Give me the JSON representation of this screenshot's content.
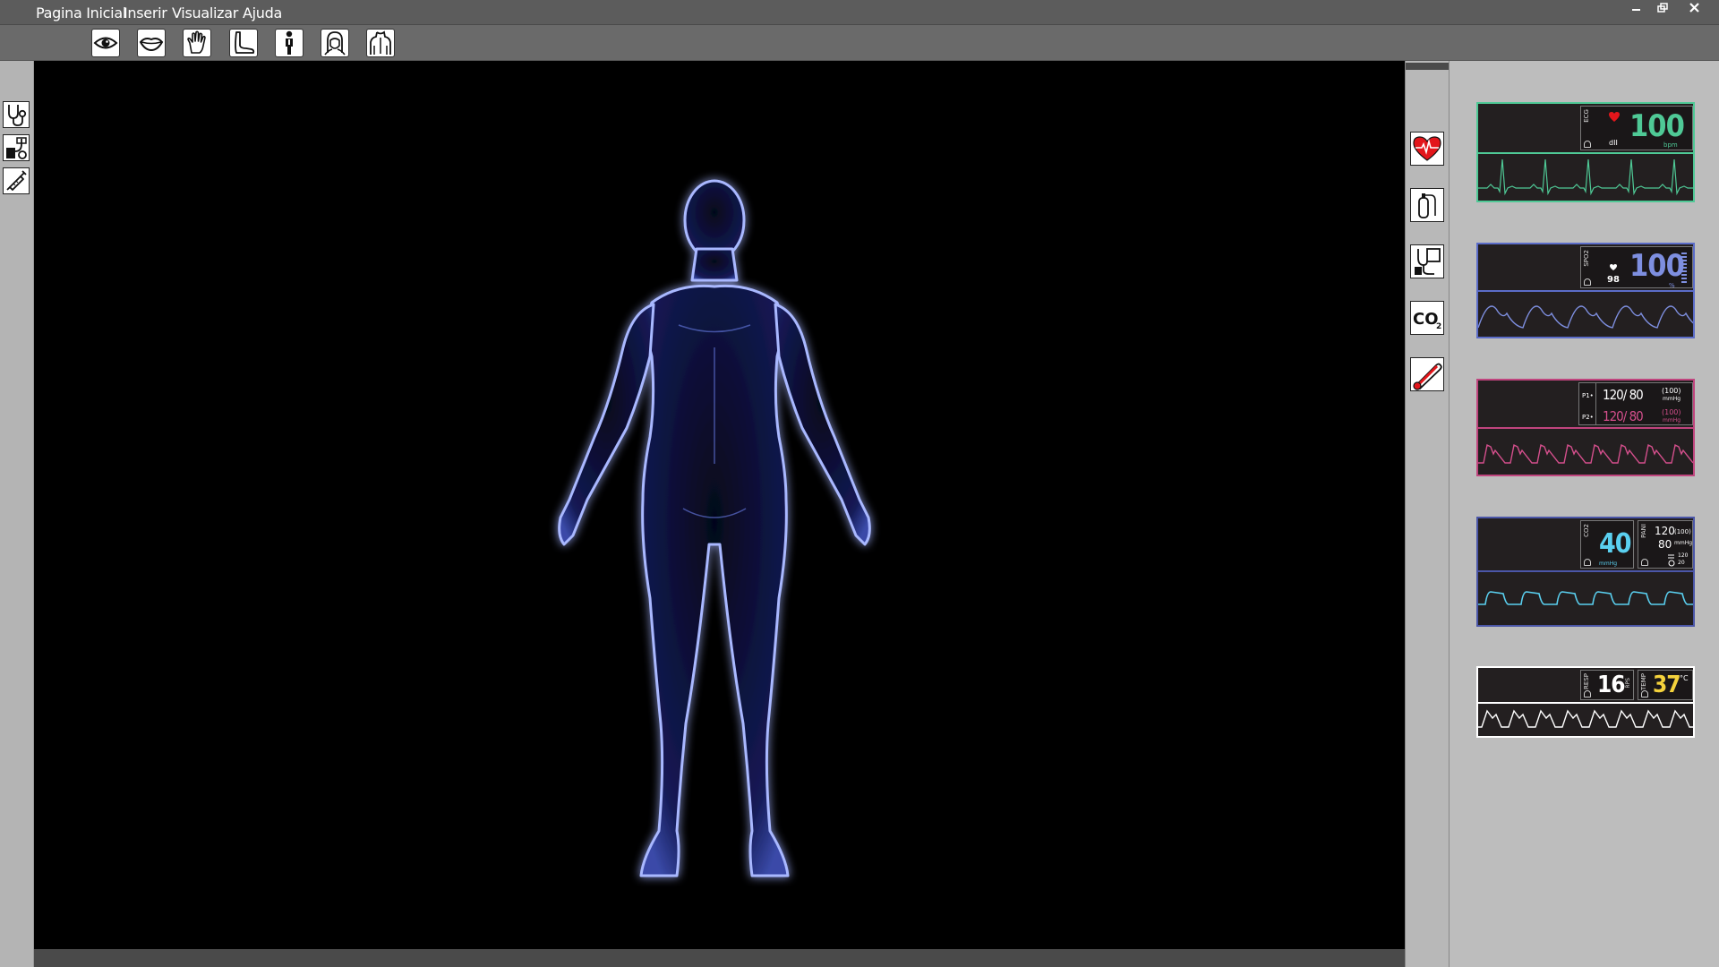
{
  "menu": {
    "items": [
      "Pagina Inicial",
      "Inserir",
      "Visualizar",
      "Ajuda"
    ],
    "window_controls": [
      "minimize-icon",
      "restore-icon",
      "close-icon"
    ]
  },
  "toolbar": {
    "tools": [
      "eye-icon",
      "mouth-icon",
      "hand-icon",
      "foot-icon",
      "body-front-icon",
      "head-front-icon",
      "torso-back-icon"
    ]
  },
  "left_tools": [
    "stethoscope-icon",
    "blood-pressure-cuff-icon",
    "syringe-icon"
  ],
  "right_tools": [
    "heart-ecg-icon",
    "oxygen-cylinder-icon",
    "blood-pressure-monitor-icon",
    "co2-icon",
    "thermometer-icon"
  ],
  "right_tool_text": {
    "co2": "CO",
    "co2_sub": "2"
  },
  "monitors": {
    "ecg": {
      "label": "ECG",
      "value": "100",
      "unit": "bpm",
      "lead": "dII",
      "color": "#4fc996"
    },
    "spo2": {
      "label": "SPO2",
      "value": "100",
      "unit": "%",
      "pulse": "98",
      "color": "#7e8fe0"
    },
    "pressure": {
      "p1_label": "P1•",
      "p2_label": "P2•",
      "p1_value": "120/ 80",
      "p1_mean": "(100)",
      "p1_unit": "mmHg",
      "p2_value": "120/ 80",
      "p2_mean": "(100)",
      "p2_unit": "mmHg",
      "color": "#d44f8c",
      "p1_color": "#ffffff"
    },
    "co2": {
      "label": "CO2",
      "value": "40",
      "unit": "mmHg",
      "pani_label": "PANI",
      "pani_sys": "120",
      "pani_dia": "80",
      "pani_mean": "(100)",
      "pani_unit": "mmHg",
      "pani_cycle": "120",
      "pani_timer": "20",
      "color": "#5ad0f0"
    },
    "resp": {
      "resp_label": "RESP",
      "resp_value": "16",
      "resp_unit": "RPS",
      "temp_label": "TEMP",
      "temp_value": "37",
      "temp_unit": "°C",
      "color": "#ffffff",
      "temp_color": "#f4d23c"
    }
  },
  "colors": {
    "menubar": "#5c5c5c",
    "viewport": "#000000",
    "body_glow": "#8aa2ff"
  }
}
